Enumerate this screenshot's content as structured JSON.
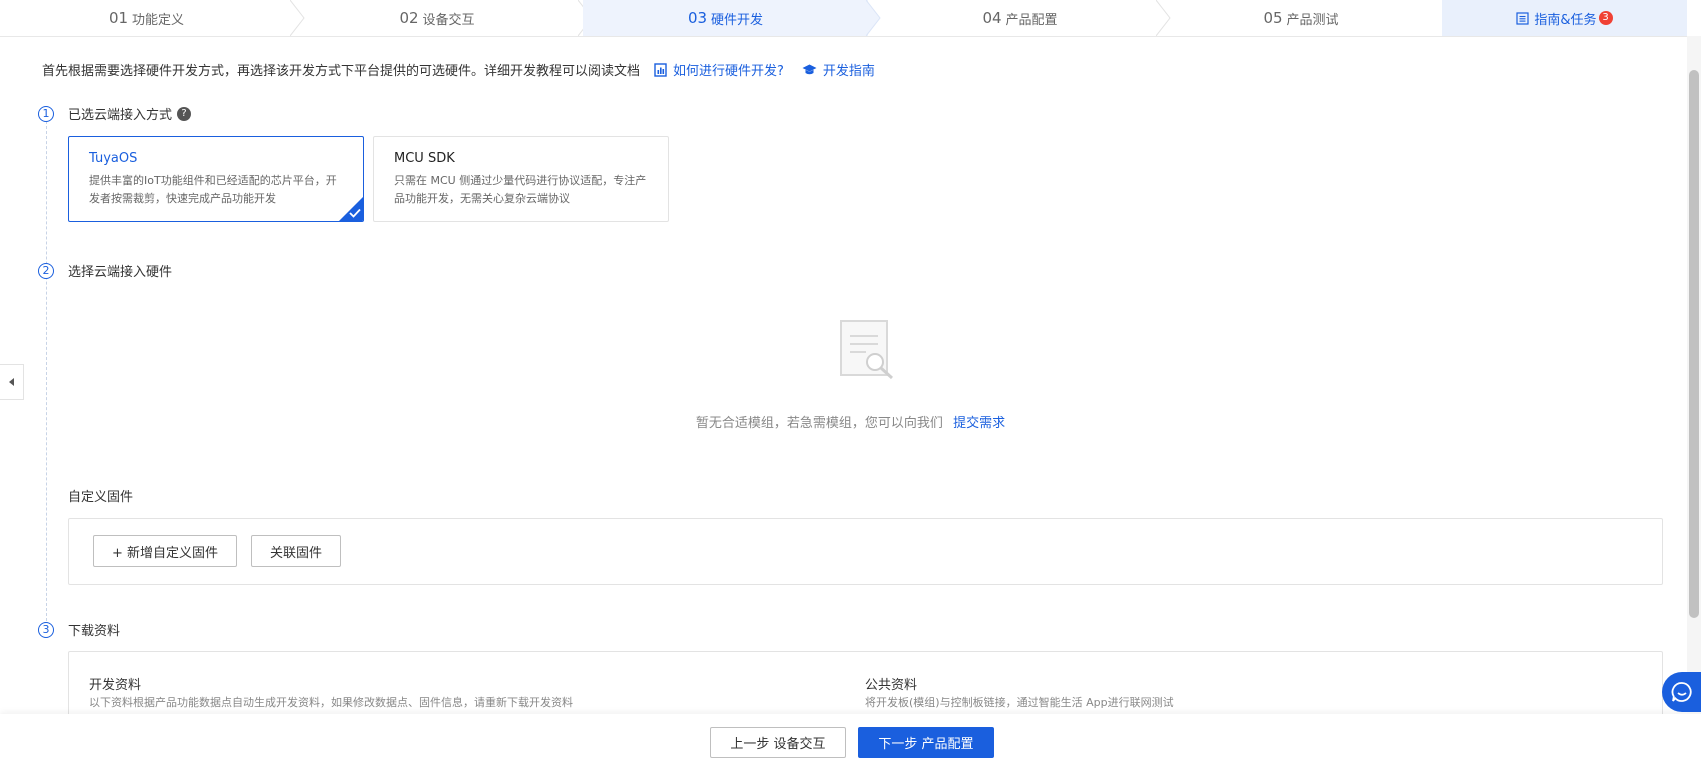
{
  "steps": [
    {
      "num": "01",
      "label": "功能定义"
    },
    {
      "num": "02",
      "label": "设备交互"
    },
    {
      "num": "03",
      "label": "硬件开发"
    },
    {
      "num": "04",
      "label": "产品配置"
    },
    {
      "num": "05",
      "label": "产品测试"
    }
  ],
  "active_step": "03",
  "guide": {
    "label": "指南&任务",
    "badge": "3",
    "icon": "list-icon"
  },
  "intro": {
    "text": "首先根据需要选择硬件开发方式，再选择该开发方式下平台提供的可选硬件。详细开发教程可以阅读文档",
    "link1": "如何进行硬件开发?",
    "link1_icon": "chart-doc-icon",
    "link2": "开发指南",
    "link2_icon": "graduation-cap-icon"
  },
  "section1": {
    "marker": "1",
    "title": "已选云端接入方式",
    "cards": [
      {
        "title": "TuyaOS",
        "desc": "提供丰富的IoT功能组件和已经适配的芯片平台，开发者按需裁剪，快速完成产品功能开发",
        "selected": true
      },
      {
        "title": "MCU SDK",
        "desc": "只需在 MCU 侧通过少量代码进行协议适配，专注产品功能开发，无需关心复杂云端协议",
        "selected": false
      }
    ]
  },
  "section2": {
    "marker": "2",
    "title": "选择云端接入硬件",
    "empty_text": "暂无合适模组，若急需模组，您可以向我们",
    "empty_link": "提交需求"
  },
  "custom_firmware": {
    "title": "自定义固件",
    "add_button": "+ 新增自定义固件",
    "link_button": "关联固件"
  },
  "section3": {
    "marker": "3",
    "title": "下载资料",
    "dev": {
      "title": "开发资料",
      "desc": "以下资料根据产品功能数据点自动生成开发资料，如果修改数据点、固件信息，请重新下载开发资料"
    },
    "public": {
      "title": "公共资料",
      "desc": "将开发板(模组)与控制板链接，通过智能生活 App进行联网测试"
    }
  },
  "footer": {
    "prev": "上一步 设备交互",
    "next": "下一步 产品配置"
  },
  "colors": {
    "primary": "#1a5fde",
    "badge": "#f04134"
  }
}
